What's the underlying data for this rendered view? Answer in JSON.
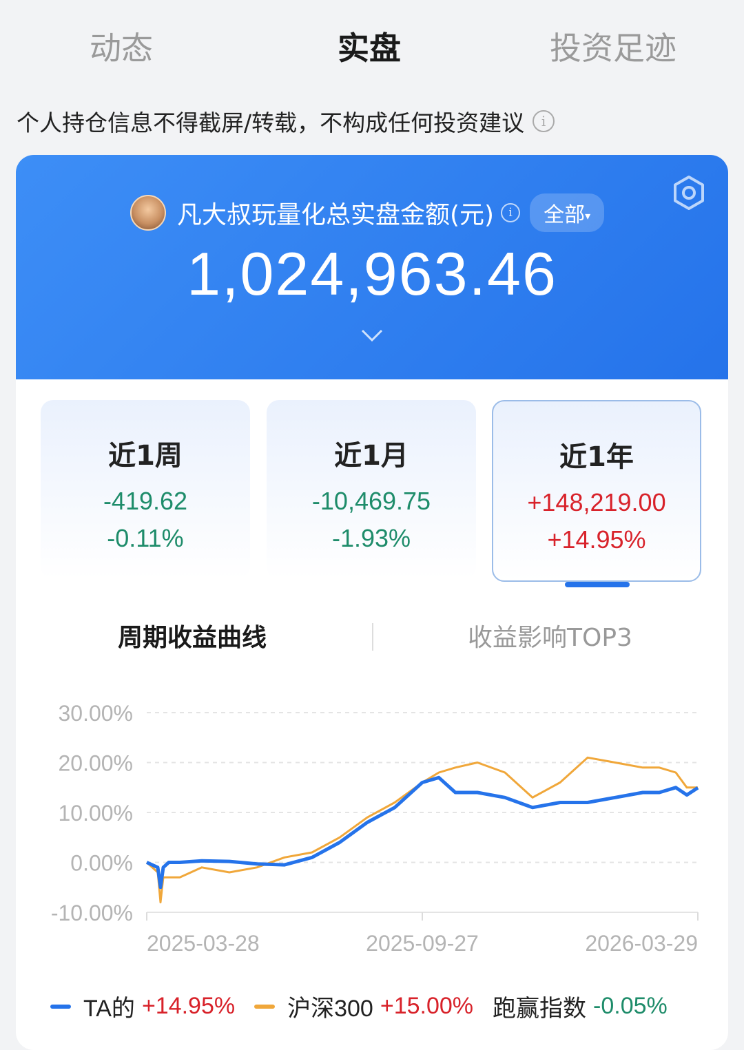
{
  "tabs": [
    "动态",
    "实盘",
    "投资足迹"
  ],
  "notice": "个人持仓信息不得截屏/转载，不构成任何投资建议",
  "hero": {
    "title": "凡大叔玩量化总实盘金额(元)",
    "filter": "全部",
    "amount": "1,024,963.46"
  },
  "periods": [
    {
      "label": "近1周",
      "value": "-419.62",
      "pct": "-0.11%",
      "trend": "down"
    },
    {
      "label": "近1月",
      "value": "-10,469.75",
      "pct": "-1.93%",
      "trend": "down"
    },
    {
      "label": "近1年",
      "value": "+148,219.00",
      "pct": "+14.95%",
      "trend": "up",
      "selected": true
    }
  ],
  "subtabs": [
    "周期收益曲线",
    "收益影响TOP3"
  ],
  "legend": [
    {
      "name": "TA的",
      "value": "+14.95%",
      "color": "#2573ea",
      "trend": "up"
    },
    {
      "name": "沪深300",
      "value": "+15.00%",
      "color": "#f0a73a",
      "trend": "up"
    },
    {
      "name": "跑赢指数",
      "value": "-0.05%",
      "trend": "down"
    }
  ],
  "colors": {
    "accent": "#2573ea",
    "up": "#d8222a",
    "down": "#1e8c6a",
    "benchmark": "#f0a73a"
  },
  "chart_data": {
    "type": "line",
    "ylim": [
      -10,
      30
    ],
    "yticks": [
      "30.00%",
      "20.00%",
      "10.00%",
      "0.00%",
      "-10.00%"
    ],
    "yvalues": [
      30,
      20,
      10,
      0,
      -10
    ],
    "xticks": [
      "2025-03-28",
      "2025-09-27",
      "2026-03-29"
    ],
    "xlim": [
      0,
      1
    ],
    "grid": true,
    "series": [
      {
        "name": "TA的",
        "color": "#2573ea",
        "x": [
          0,
          0.02,
          0.025,
          0.03,
          0.04,
          0.06,
          0.1,
          0.15,
          0.2,
          0.25,
          0.3,
          0.35,
          0.4,
          0.45,
          0.5,
          0.53,
          0.56,
          0.6,
          0.65,
          0.7,
          0.75,
          0.8,
          0.85,
          0.9,
          0.93,
          0.96,
          0.98,
          1.0
        ],
        "values": [
          0,
          -1,
          -5,
          -1,
          0,
          0,
          0.3,
          0.2,
          -0.3,
          -0.5,
          1,
          4,
          8,
          11,
          16,
          17,
          14,
          14,
          13,
          11,
          12,
          12,
          13,
          14,
          14,
          15,
          13.5,
          14.95
        ]
      },
      {
        "name": "沪深300",
        "color": "#f0a73a",
        "x": [
          0,
          0.02,
          0.025,
          0.03,
          0.06,
          0.1,
          0.15,
          0.2,
          0.25,
          0.3,
          0.35,
          0.4,
          0.45,
          0.5,
          0.53,
          0.56,
          0.6,
          0.65,
          0.7,
          0.75,
          0.8,
          0.85,
          0.9,
          0.93,
          0.96,
          0.98,
          1.0
        ],
        "values": [
          0,
          -2,
          -8,
          -3,
          -3,
          -1,
          -2,
          -1,
          1,
          2,
          5,
          9,
          12,
          16,
          18,
          19,
          20,
          18,
          13,
          16,
          21,
          20,
          19,
          19,
          18,
          15,
          15.0
        ]
      }
    ]
  }
}
